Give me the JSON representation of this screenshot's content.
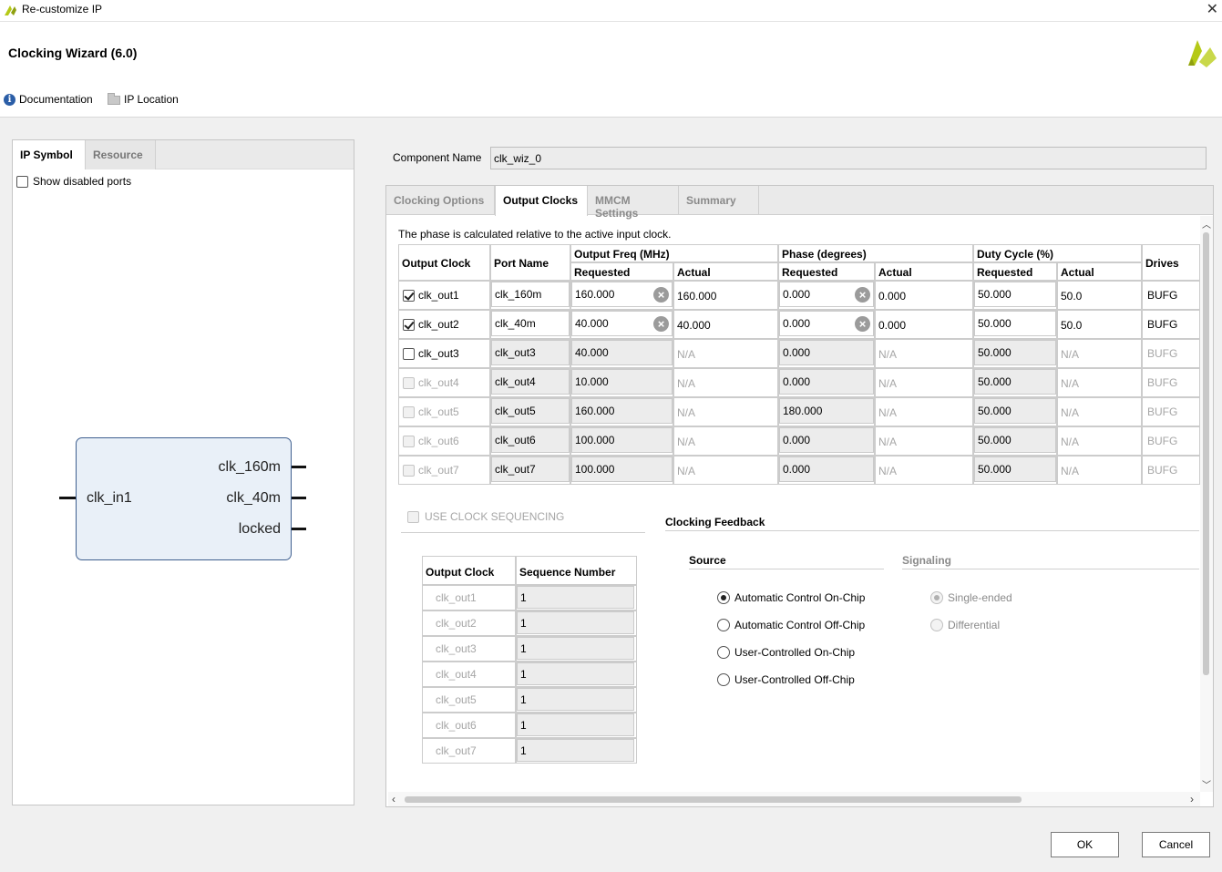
{
  "window": {
    "title": "Re-customize IP",
    "close_glyph": "✕"
  },
  "header": {
    "wizard_title": "Clocking Wizard (6.0)",
    "documentation": "Documentation",
    "ip_location": "IP Location"
  },
  "left_panel": {
    "tabs": [
      "IP Symbol",
      "Resource"
    ],
    "show_disabled_label": "Show disabled ports",
    "show_disabled_checked": false,
    "symbol": {
      "input_port": "clk_in1",
      "output_ports": [
        "clk_160m",
        "clk_40m",
        "locked"
      ]
    }
  },
  "component": {
    "label": "Component Name",
    "value": "clk_wiz_0"
  },
  "tabs": [
    "Clocking Options",
    "Output Clocks",
    "MMCM Settings",
    "Summary"
  ],
  "active_tab": "Output Clocks",
  "phase_note": "The phase is calculated relative to the active input clock.",
  "output_table": {
    "headers": {
      "output_clock": "Output Clock",
      "port_name": "Port Name",
      "output_freq": "Output Freq (MHz)",
      "phase": "Phase (degrees)",
      "duty_cycle": "Duty Cycle (%)",
      "drives": "Drives",
      "requested": "Requested",
      "actual": "Actual"
    },
    "rows": [
      {
        "clock": "clk_out1",
        "checked": true,
        "enabled": true,
        "port": "clk_160m",
        "freq_req": "160.000",
        "freq_act": "160.000",
        "phase_req": "0.000",
        "phase_act": "0.000",
        "duty_req": "50.000",
        "duty_act": "50.0",
        "drives": "BUFG"
      },
      {
        "clock": "clk_out2",
        "checked": true,
        "enabled": true,
        "port": "clk_40m",
        "freq_req": "40.000",
        "freq_act": "40.000",
        "phase_req": "0.000",
        "phase_act": "0.000",
        "duty_req": "50.000",
        "duty_act": "50.0",
        "drives": "BUFG"
      },
      {
        "clock": "clk_out3",
        "checked": false,
        "enabled": true,
        "port": "clk_out3",
        "freq_req": "40.000",
        "freq_act": "N/A",
        "phase_req": "0.000",
        "phase_act": "N/A",
        "duty_req": "50.000",
        "duty_act": "N/A",
        "drives": "BUFG"
      },
      {
        "clock": "clk_out4",
        "checked": false,
        "enabled": false,
        "port": "clk_out4",
        "freq_req": "10.000",
        "freq_act": "N/A",
        "phase_req": "0.000",
        "phase_act": "N/A",
        "duty_req": "50.000",
        "duty_act": "N/A",
        "drives": "BUFG"
      },
      {
        "clock": "clk_out5",
        "checked": false,
        "enabled": false,
        "port": "clk_out5",
        "freq_req": "160.000",
        "freq_act": "N/A",
        "phase_req": "180.000",
        "phase_act": "N/A",
        "duty_req": "50.000",
        "duty_act": "N/A",
        "drives": "BUFG"
      },
      {
        "clock": "clk_out6",
        "checked": false,
        "enabled": false,
        "port": "clk_out6",
        "freq_req": "100.000",
        "freq_act": "N/A",
        "phase_req": "0.000",
        "phase_act": "N/A",
        "duty_req": "50.000",
        "duty_act": "N/A",
        "drives": "BUFG"
      },
      {
        "clock": "clk_out7",
        "checked": false,
        "enabled": false,
        "port": "clk_out7",
        "freq_req": "100.000",
        "freq_act": "N/A",
        "phase_req": "0.000",
        "phase_act": "N/A",
        "duty_req": "50.000",
        "duty_act": "N/A",
        "drives": "BUFG"
      }
    ]
  },
  "sequencing": {
    "label": "USE CLOCK SEQUENCING",
    "checked": false,
    "headers": [
      "Output Clock",
      "Sequence Number"
    ],
    "rows": [
      {
        "clock": "clk_out1",
        "seq": "1"
      },
      {
        "clock": "clk_out2",
        "seq": "1"
      },
      {
        "clock": "clk_out3",
        "seq": "1"
      },
      {
        "clock": "clk_out4",
        "seq": "1"
      },
      {
        "clock": "clk_out5",
        "seq": "1"
      },
      {
        "clock": "clk_out6",
        "seq": "1"
      },
      {
        "clock": "clk_out7",
        "seq": "1"
      }
    ]
  },
  "feedback": {
    "title": "Clocking Feedback",
    "source_title": "Source",
    "signaling_title": "Signaling",
    "source_options": [
      "Automatic Control On-Chip",
      "Automatic Control Off-Chip",
      "User-Controlled On-Chip",
      "User-Controlled Off-Chip"
    ],
    "source_selected": 0,
    "signaling_options": [
      "Single-ended",
      "Differential"
    ],
    "signaling_selected": 0
  },
  "buttons": {
    "ok": "OK",
    "cancel": "Cancel"
  },
  "colors": {
    "brand": "#b5c917",
    "symbol_fill": "#e9f0f8",
    "symbol_border": "#3f5f8f",
    "info_icon": "#2b5ea7"
  }
}
